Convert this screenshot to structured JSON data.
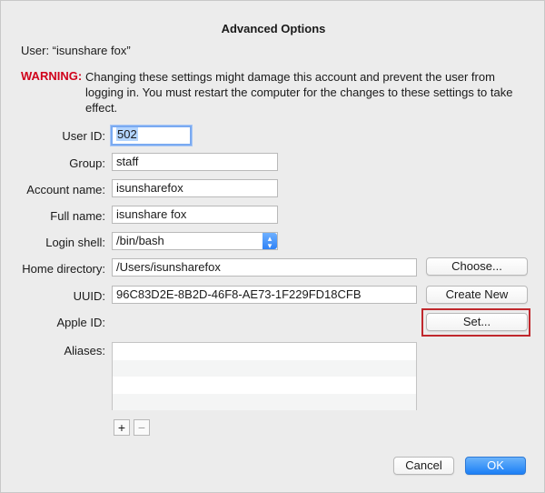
{
  "dialog": {
    "title": "Advanced Options",
    "user_line": "User:  “isunshare fox”",
    "warning_label": "WARNING:",
    "warning_text": "Changing these settings might damage this account and prevent the user from logging in. You must restart the computer for the changes to these settings to take effect."
  },
  "fields": {
    "user_id": {
      "label": "User ID:",
      "value": "502"
    },
    "group": {
      "label": "Group:",
      "value": "staff"
    },
    "account_name": {
      "label": "Account name:",
      "value": "isunsharefox"
    },
    "full_name": {
      "label": "Full name:",
      "value": "isunshare fox"
    },
    "login_shell": {
      "label": "Login shell:",
      "value": "/bin/bash"
    },
    "home_directory": {
      "label": "Home directory:",
      "value": "/Users/isunsharefox"
    },
    "uuid": {
      "label": "UUID:",
      "value": "96C83D2E-8B2D-46F8-AE73-1F229FD18CFB"
    },
    "apple_id": {
      "label": "Apple ID:"
    },
    "aliases": {
      "label": "Aliases:"
    }
  },
  "buttons": {
    "choose": "Choose...",
    "create_new": "Create New",
    "set": "Set...",
    "add": "+",
    "remove": "−",
    "cancel": "Cancel",
    "ok": "OK"
  },
  "icons": {
    "popup": "chevron-updown-icon"
  },
  "colors": {
    "warning": "#d0021b",
    "accent": "#1b7ff6",
    "highlight_box": "#c0282d"
  }
}
